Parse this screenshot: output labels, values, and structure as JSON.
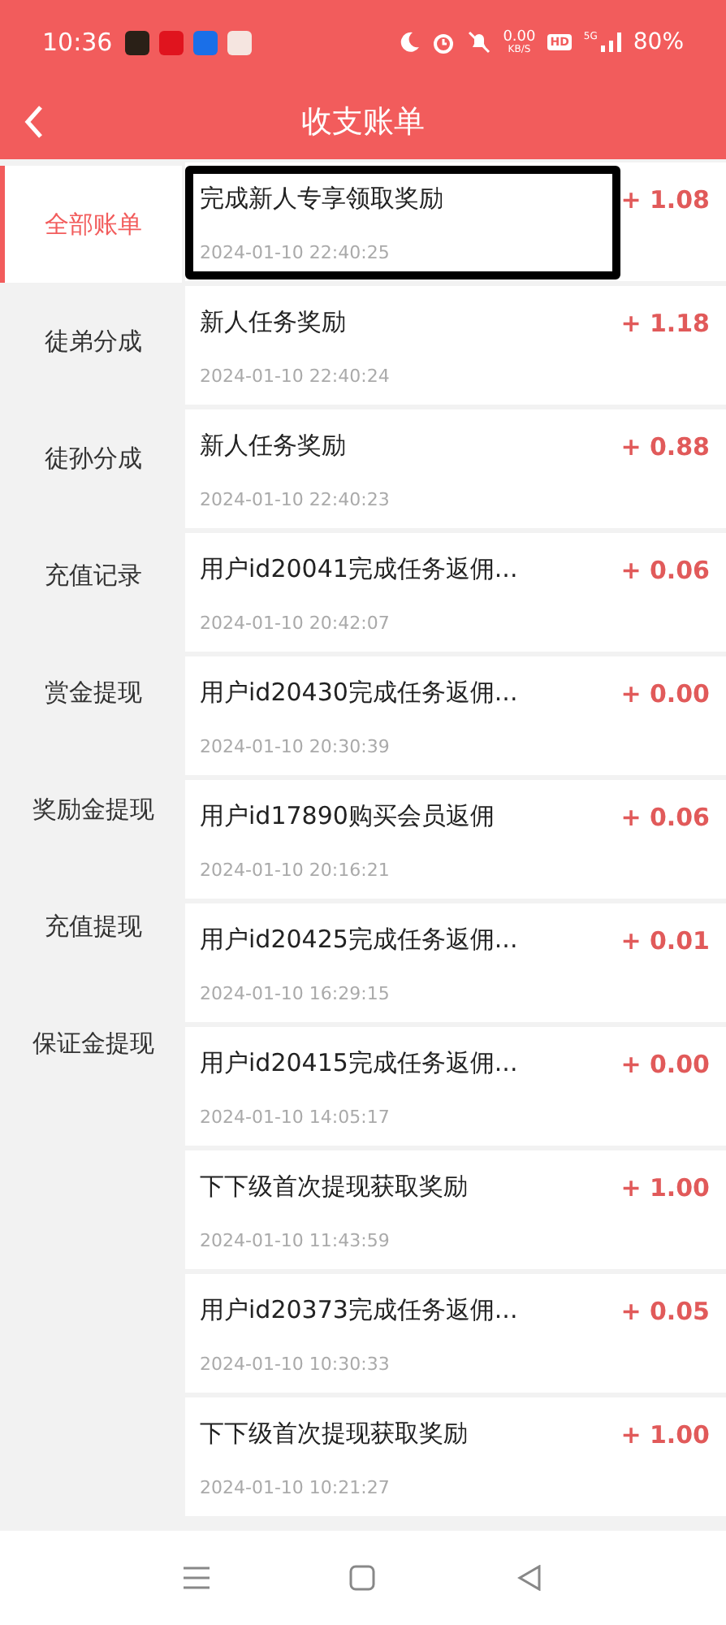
{
  "status_bar": {
    "time": "10:36",
    "net_speed": "0.00",
    "net_unit": "KB/S",
    "hd": "HD",
    "network": "5G",
    "battery": "80%"
  },
  "header": {
    "title": "收支账单"
  },
  "sidebar": {
    "items": [
      {
        "label": "全部账单",
        "selected": true
      },
      {
        "label": "徒弟分成",
        "selected": false
      },
      {
        "label": "徒孙分成",
        "selected": false
      },
      {
        "label": "充值记录",
        "selected": false
      },
      {
        "label": "赏金提现",
        "selected": false
      },
      {
        "label": "奖励金提现",
        "selected": false
      },
      {
        "label": "充值提现",
        "selected": false
      },
      {
        "label": "保证金提现",
        "selected": false
      }
    ]
  },
  "records": [
    {
      "title": "完成新人专享领取奖励",
      "time": "2024-01-10 22:40:25",
      "amount": "+ 1.08",
      "highlighted": true
    },
    {
      "title": "新人任务奖励",
      "time": "2024-01-10 22:40:24",
      "amount": "+ 1.18",
      "highlighted": false
    },
    {
      "title": "新人任务奖励",
      "time": "2024-01-10 22:40:23",
      "amount": "+ 0.88",
      "highlighted": false
    },
    {
      "title": "用户id20041完成任务返佣...",
      "time": "2024-01-10 20:42:07",
      "amount": "+ 0.06",
      "highlighted": false
    },
    {
      "title": "用户id20430完成任务返佣...",
      "time": "2024-01-10 20:30:39",
      "amount": "+ 0.00",
      "highlighted": false
    },
    {
      "title": "用户id17890购买会员返佣",
      "time": "2024-01-10 20:16:21",
      "amount": "+ 0.06",
      "highlighted": false
    },
    {
      "title": "用户id20425完成任务返佣...",
      "time": "2024-01-10 16:29:15",
      "amount": "+ 0.01",
      "highlighted": false
    },
    {
      "title": "用户id20415完成任务返佣...",
      "time": "2024-01-10 14:05:17",
      "amount": "+ 0.00",
      "highlighted": false
    },
    {
      "title": "下下级首次提现获取奖励",
      "time": "2024-01-10 11:43:59",
      "amount": "+ 1.00",
      "highlighted": false
    },
    {
      "title": "用户id20373完成任务返佣...",
      "time": "2024-01-10 10:30:33",
      "amount": "+ 0.05",
      "highlighted": false
    },
    {
      "title": "下下级首次提现获取奖励",
      "time": "2024-01-10 10:21:27",
      "amount": "+ 1.00",
      "highlighted": false
    }
  ]
}
